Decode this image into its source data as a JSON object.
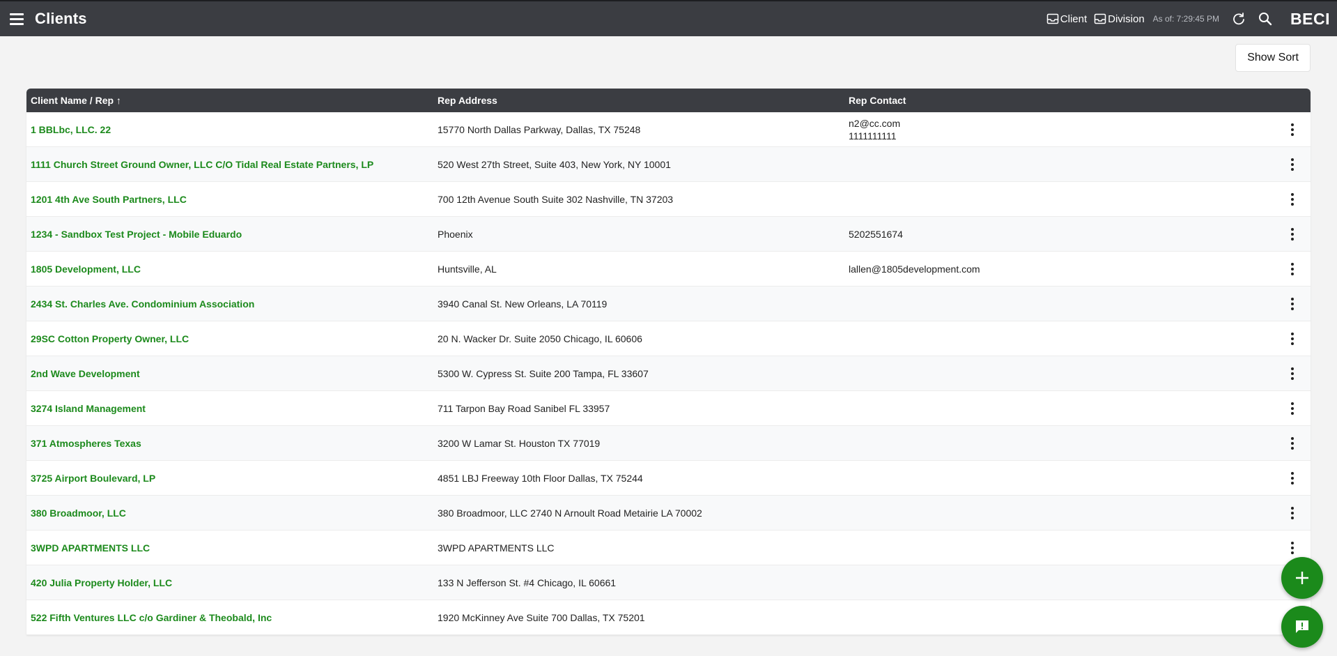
{
  "header": {
    "title": "Clients",
    "client_link": "Client",
    "division_link": "Division",
    "as_of": "As of: 7:29:45 PM",
    "brand": "BECI"
  },
  "toolbar": {
    "show_sort_label": "Show Sort"
  },
  "table": {
    "columns": [
      "Client Name / Rep ↑",
      "Rep Address",
      "Rep Contact"
    ],
    "rows": [
      {
        "name": "1 BBLbc, LLC. 22",
        "address": "15770 North Dallas Parkway, Dallas, TX 75248",
        "contact1": "n2@cc.com",
        "contact2": "1111111111"
      },
      {
        "name": "1111 Church Street Ground Owner, LLC  C/O Tidal Real Estate Partners, LP",
        "address": "520 West 27th Street, Suite 403,  New York, NY 10001",
        "contact1": "",
        "contact2": ""
      },
      {
        "name": "1201 4th Ave South Partners, LLC",
        "address": "700 12th Avenue South Suite 302 Nashville, TN 37203",
        "contact1": "",
        "contact2": ""
      },
      {
        "name": "1234 - Sandbox Test Project - Mobile Eduardo",
        "address": "Phoenix",
        "contact1": "5202551674",
        "contact2": ""
      },
      {
        "name": "1805 Development, LLC",
        "address": "Huntsville, AL",
        "contact1": "lallen@1805development.com",
        "contact2": ""
      },
      {
        "name": "2434 St. Charles Ave. Condominium Association",
        "address": "3940 Canal St. New Orleans, LA 70119",
        "contact1": "",
        "contact2": ""
      },
      {
        "name": "29SC Cotton Property Owner, LLC",
        "address": "20 N. Wacker Dr. Suite 2050 Chicago, IL 60606",
        "contact1": "",
        "contact2": ""
      },
      {
        "name": "2nd Wave Development",
        "address": "5300 W. Cypress St. Suite 200 Tampa, FL 33607",
        "contact1": "",
        "contact2": ""
      },
      {
        "name": "3274 Island Management",
        "address": "711 Tarpon Bay Road Sanibel FL 33957",
        "contact1": "",
        "contact2": ""
      },
      {
        "name": "371 Atmospheres Texas",
        "address": "3200 W Lamar St. Houston TX 77019",
        "contact1": "",
        "contact2": ""
      },
      {
        "name": "3725 Airport Boulevard, LP",
        "address": "4851 LBJ Freeway 10th Floor Dallas, TX 75244",
        "contact1": "",
        "contact2": ""
      },
      {
        "name": "380 Broadmoor, LLC",
        "address": "380 Broadmoor, LLC 2740 N Arnoult Road Metairie LA 70002",
        "contact1": "",
        "contact2": ""
      },
      {
        "name": "3WPD APARTMENTS LLC",
        "address": "3WPD APARTMENTS LLC",
        "contact1": "",
        "contact2": ""
      },
      {
        "name": "420 Julia Property Holder, LLC",
        "address": "133 N Jefferson St. #4 Chicago, IL 60661",
        "contact1": "",
        "contact2": ""
      },
      {
        "name": "522 Fifth Ventures LLC c/o Gardiner & Theobald, Inc",
        "address": "1920 McKinney Ave Suite 700 Dallas, TX 75201",
        "contact1": "",
        "contact2": ""
      }
    ]
  },
  "colors": {
    "topbar": "#3b3d42",
    "link_green": "#1c8a1c",
    "fab_green": "#1b8a1b"
  }
}
